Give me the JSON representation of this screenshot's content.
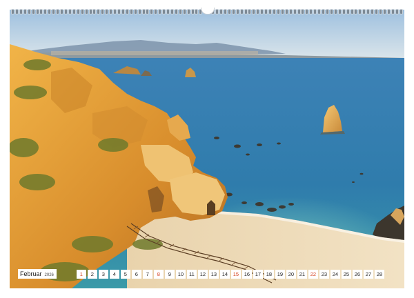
{
  "calendar": {
    "month": "Februar",
    "year": "2026",
    "days": [
      "1",
      "2",
      "3",
      "4",
      "5",
      "6",
      "7",
      "8",
      "9",
      "10",
      "11",
      "12",
      "13",
      "14",
      "15",
      "16",
      "17",
      "18",
      "19",
      "20",
      "21",
      "22",
      "23",
      "24",
      "25",
      "26",
      "27",
      "28"
    ],
    "sunday_indices": [
      0,
      7,
      14,
      21
    ],
    "sunday_color": "#d43d1a"
  },
  "photo": {
    "subject": "coastal-cliffs-beach-photo",
    "colors": {
      "sky_top": "#a9c7e2",
      "sea": "#2e7fb0",
      "sea_shallow": "#5fb4b6",
      "cliff": "#e1a23c",
      "sand": "#ecd8b2"
    }
  }
}
